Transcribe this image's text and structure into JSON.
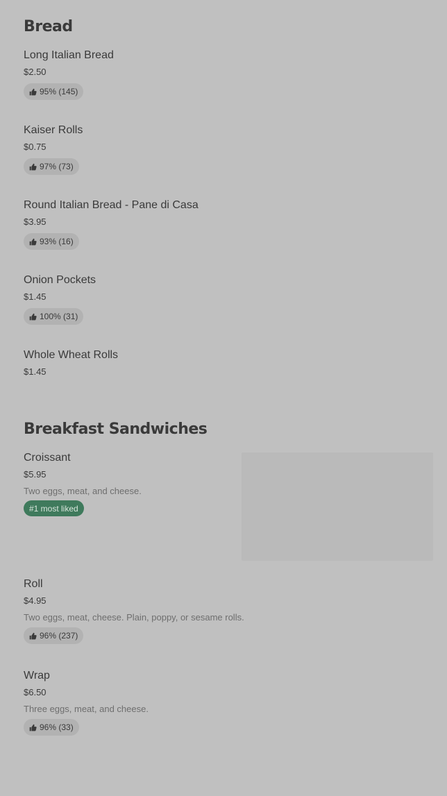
{
  "sections": [
    {
      "title": "Bread",
      "items": [
        {
          "name": "Long Italian Bread",
          "price": "$2.50",
          "rating": "95% (145)"
        },
        {
          "name": "Kaiser Rolls",
          "price": "$0.75",
          "rating": "97% (73)"
        },
        {
          "name": "Round Italian Bread - Pane di Casa",
          "price": "$3.95",
          "rating": "93% (16)"
        },
        {
          "name": "Onion Pockets",
          "price": "$1.45",
          "rating": "100% (31)"
        },
        {
          "name": "Whole Wheat Rolls",
          "price": "$1.45"
        }
      ]
    },
    {
      "title": "Breakfast Sandwiches",
      "items": [
        {
          "name": "Croissant",
          "price": "$5.95",
          "description": "Two eggs, meat, and cheese.",
          "badge": "#1 most liked"
        },
        {
          "name": "Roll",
          "price": "$4.95",
          "description": "Two eggs, meat, cheese. Plain, poppy, or sesame rolls.",
          "rating": "96% (237)"
        },
        {
          "name": "Wrap",
          "price": "$6.50",
          "description": "Three eggs, meat, and cheese.",
          "rating": "96% (33)"
        }
      ]
    }
  ],
  "icons": {
    "rating": "thumbs-up-icon"
  },
  "colors": {
    "background": "#c0c0c0",
    "badge": "#3f7a5c",
    "pill": "#b2b2b2"
  }
}
